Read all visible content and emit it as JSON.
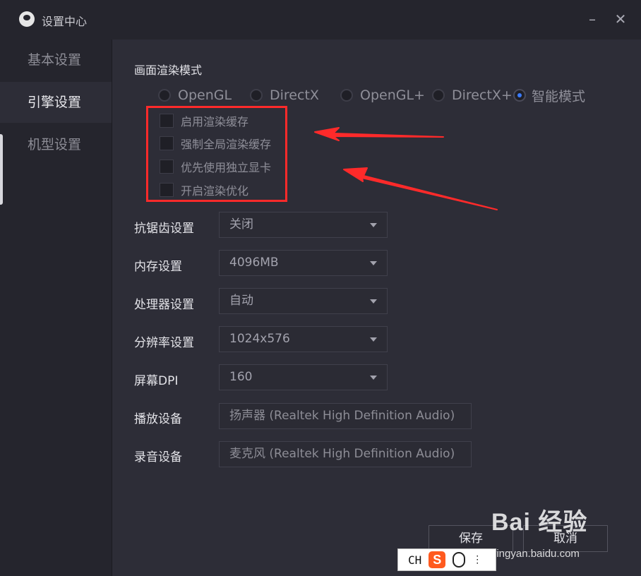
{
  "window": {
    "title": "设置中心",
    "minimize_icon": "minimize-icon",
    "close_icon": "close-icon"
  },
  "sidebar": {
    "items": [
      {
        "label": "基本设置",
        "active": false
      },
      {
        "label": "引擎设置",
        "active": true
      },
      {
        "label": "机型设置",
        "active": false
      }
    ]
  },
  "render": {
    "section_title": "画面渲染模式",
    "modes": [
      {
        "label": "OpenGL",
        "selected": false
      },
      {
        "label": "DirectX",
        "selected": false
      },
      {
        "label": "OpenGL+",
        "selected": false
      },
      {
        "label": "DirectX+",
        "selected": false
      },
      {
        "label": "智能模式",
        "selected": true
      }
    ],
    "options": [
      {
        "label": "启用渲染缓存",
        "checked": false
      },
      {
        "label": "强制全局渲染缓存",
        "checked": false
      },
      {
        "label": "优先使用独立显卡",
        "checked": false
      },
      {
        "label": "开启渲染优化",
        "checked": false
      }
    ]
  },
  "form": {
    "antialias": {
      "label": "抗锯齿设置",
      "value": "关闭"
    },
    "memory": {
      "label": "内存设置",
      "value": "4096MB"
    },
    "cpu": {
      "label": "处理器设置",
      "value": "自动"
    },
    "resolution": {
      "label": "分辨率设置",
      "value": "1024x576"
    },
    "dpi": {
      "label": "屏幕DPI",
      "value": "160"
    },
    "playback": {
      "label": "播放设备",
      "value": "扬声器 (Realtek High Definition Audio)"
    },
    "recording": {
      "label": "录音设备",
      "value": "麦克风 (Realtek High Definition Audio)"
    }
  },
  "buttons": {
    "save": "保存",
    "cancel": "取消"
  },
  "ime": {
    "lang": "CH",
    "brand": "S"
  },
  "watermark": {
    "text": "Bai  经验",
    "url": "jingyan.baidu.com"
  },
  "colors": {
    "accent": "#3a7bff",
    "annotation": "#ff2a2a"
  }
}
